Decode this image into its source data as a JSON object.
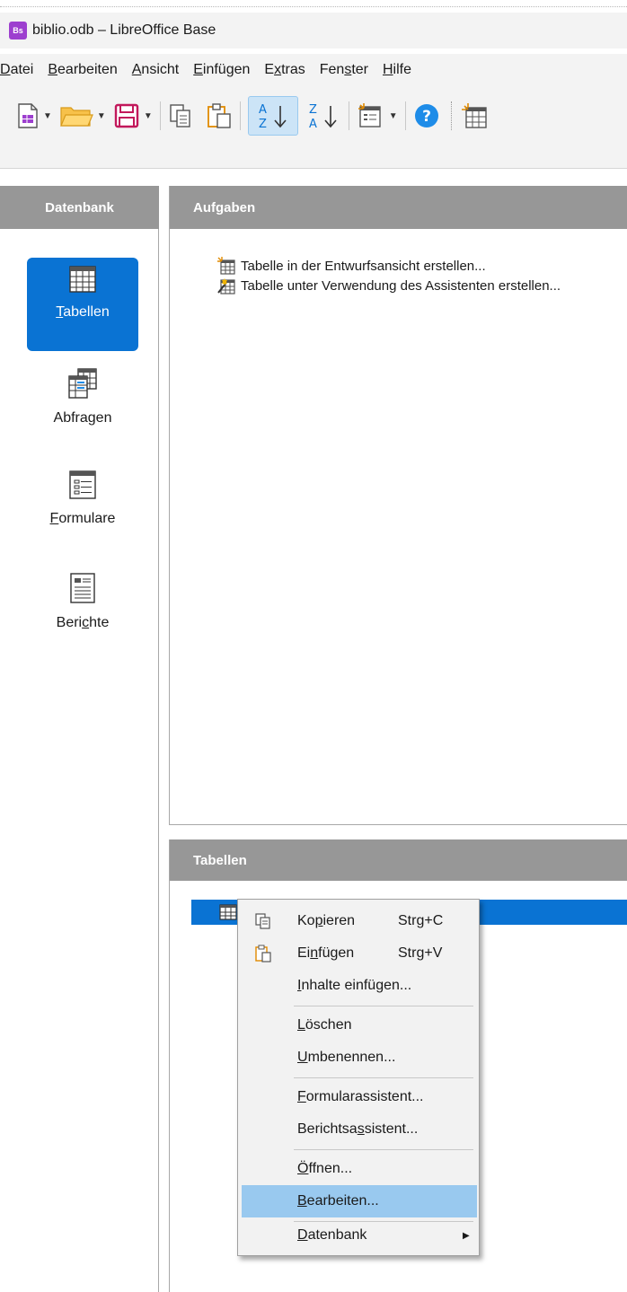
{
  "window": {
    "title": "biblio.odb – LibreOffice Base",
    "app_icon_text": "Bs"
  },
  "menubar": [
    {
      "pre": "",
      "u": "D",
      "post": "atei"
    },
    {
      "pre": "",
      "u": "B",
      "post": "earbeiten"
    },
    {
      "pre": "",
      "u": "A",
      "post": "nsicht"
    },
    {
      "pre": "",
      "u": "E",
      "post": "infügen"
    },
    {
      "pre": "E",
      "u": "x",
      "post": "tras"
    },
    {
      "pre": "Fen",
      "u": "s",
      "post": "ter"
    },
    {
      "pre": "",
      "u": "H",
      "post": "ilfe"
    }
  ],
  "toolbar": {
    "icons": [
      "new-document-icon",
      "open-folder-icon",
      "save-icon",
      "copy-icon",
      "paste-icon",
      "sort-ascending-icon",
      "sort-descending-icon",
      "form-icon",
      "help-icon",
      "table-design-icon"
    ],
    "sort_asc_active": true
  },
  "left_panel": {
    "header": "Datenbank",
    "items": [
      {
        "id": "tabellen",
        "pre": "",
        "u": "T",
        "post": "abellen",
        "selected": true
      },
      {
        "id": "abfragen",
        "pre": "Abfra",
        "u": "g",
        "post": "en",
        "selected": false
      },
      {
        "id": "formulare",
        "pre": "",
        "u": "F",
        "post": "ormulare",
        "selected": false
      },
      {
        "id": "berichte",
        "pre": "Beri",
        "u": "c",
        "post": "hte",
        "selected": false
      }
    ]
  },
  "tasks_panel": {
    "header": "Aufgaben",
    "tasks": [
      "Tabelle in der Entwurfsansicht erstellen...",
      "Tabelle unter Verwendung des Assistenten erstellen..."
    ]
  },
  "tables_panel": {
    "header": "Tabellen",
    "selected_row_text": ""
  },
  "context_menu": {
    "items": [
      {
        "pre": "Ko",
        "u": "p",
        "post": "ieren",
        "shortcut": "Strg+C",
        "icon": "copy-icon"
      },
      {
        "pre": "Ei",
        "u": "n",
        "post": "fügen",
        "shortcut": "Strg+V",
        "icon": "paste-icon"
      },
      {
        "pre": "",
        "u": "I",
        "post": "nhalte einfügen...",
        "shortcut": ""
      },
      {
        "pre": "",
        "u": "L",
        "post": "öschen",
        "shortcut": ""
      },
      {
        "pre": "",
        "u": "U",
        "post": "mbenennen...",
        "shortcut": ""
      },
      {
        "pre": "",
        "u": "F",
        "post": "ormularassistent...",
        "shortcut": ""
      },
      {
        "pre": "Berichtsa",
        "u": "s",
        "post": "sistent...",
        "shortcut": ""
      },
      {
        "pre": "",
        "u": "Ö",
        "post": "ffnen...",
        "shortcut": ""
      },
      {
        "pre": "",
        "u": "B",
        "post": "earbeiten...",
        "shortcut": "",
        "highlighted": true
      },
      {
        "pre": "",
        "u": "D",
        "post": "atenbank",
        "shortcut": "",
        "submenu": true
      }
    ]
  },
  "colors": {
    "accent": "#0a73d3",
    "header_grey": "#979797",
    "menu_highlight": "#99c9ef"
  }
}
